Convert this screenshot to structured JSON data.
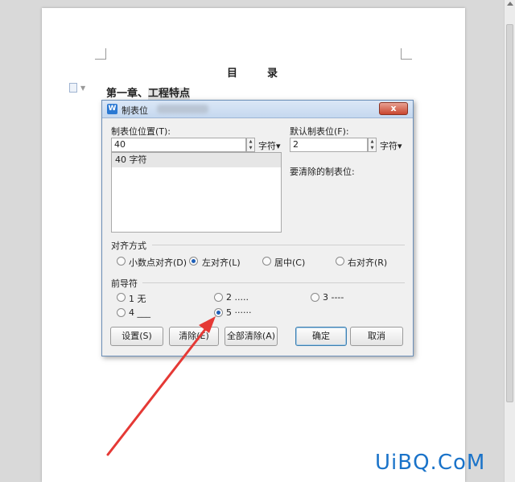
{
  "document": {
    "title": "目　录",
    "chapter": "第一章、",
    "chapter_highlight": "工程特点"
  },
  "dialog": {
    "title": "制表位",
    "close_label": "x",
    "tab_position_label": "制表位位置(T):",
    "tab_position_value": "40",
    "tab_unit": "字符▾",
    "default_tab_label": "默认制表位(F):",
    "default_tab_value": "2",
    "default_unit": "字符▾",
    "list_items": [
      "40 字符"
    ],
    "to_clear_label": "要清除的制表位:",
    "alignment": {
      "label": "对齐方式",
      "options": [
        "小数点对齐(D)",
        "左对齐(L)",
        "居中(C)",
        "右对齐(R)"
      ],
      "selected": "左对齐(L)"
    },
    "leader": {
      "label": "前导符",
      "options": [
        "1 无",
        "2 .....",
        "3 ----",
        "4 ___",
        "5 ······"
      ],
      "selected": "5 ······"
    },
    "buttons": {
      "set": "设置(S)",
      "clear": "清除(E)",
      "clear_all": "全部清除(A)",
      "ok": "确定",
      "cancel": "取消"
    }
  },
  "watermark": "UiBQ.CoM",
  "colors": {
    "arrow": "#e53935",
    "watermark": "#1a73c9",
    "selection_dot": "#1e5fb8"
  }
}
